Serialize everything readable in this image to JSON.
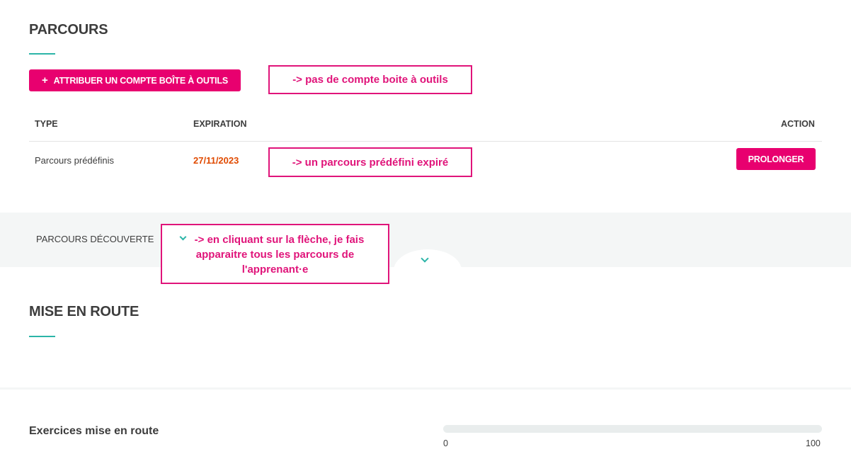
{
  "parcours_section": {
    "title": "PARCOURS",
    "assign_button_label": "ATTRIBUER UN COMPTE BOÎTE À OUTILS",
    "annotation_no_account": "-> pas de compte boite à outils",
    "table": {
      "headers": {
        "type": "TYPE",
        "expiration": "EXPIRATION",
        "action": "ACTION"
      },
      "rows": [
        {
          "type": "Parcours prédéfinis",
          "expiration": "27/11/2023",
          "action_label": "PROLONGER"
        }
      ]
    },
    "annotation_expired": "-> un parcours prédéfini expiré",
    "colors": {
      "accent": "#e8006f",
      "expired": "#e04a00",
      "underline": "#2cb5a8"
    }
  },
  "discovery_band": {
    "label": "PARCOURS DÉCOUVERTE",
    "annotation_lines": [
      "-> en cliquant sur la flèche,  je fais",
      "apparaitre tous les parcours de",
      "l'apprenant·e"
    ],
    "icons": [
      "chevron-down-icon",
      "chevron-down-icon"
    ]
  },
  "mise_en_route": {
    "title": "MISE EN ROUTE",
    "exercise_label": "Exercices mise en route",
    "progress": {
      "min_label": "0",
      "max_label": "100",
      "value_fraction": 0
    }
  }
}
